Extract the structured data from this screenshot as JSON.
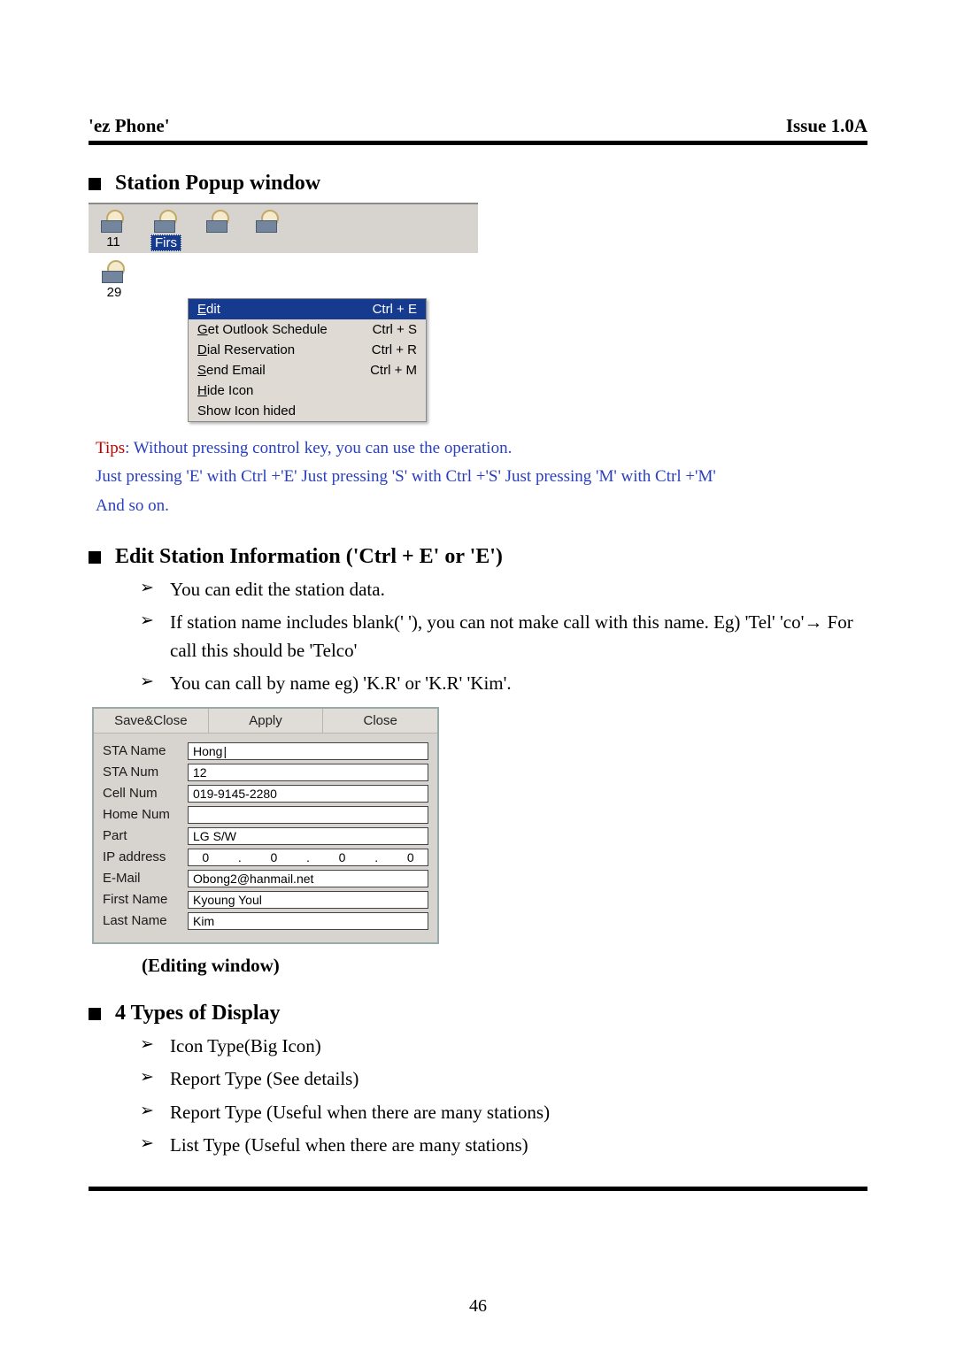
{
  "header": {
    "left": "'ez Phone'",
    "right": "Issue 1.0A"
  },
  "section_popup": {
    "title": "Station Popup window"
  },
  "popup": {
    "icon1_label": "11",
    "icon2_label": "Firs",
    "icon3_label": "29",
    "menu": {
      "item1": {
        "label_pre": "",
        "label_ul": "E",
        "label_post": "dit",
        "shortcut": "Ctrl + E"
      },
      "item2": {
        "label_pre": "",
        "label_ul": "G",
        "label_post": "et Outlook Schedule",
        "shortcut": "Ctrl + S"
      },
      "item3": {
        "label_pre": "",
        "label_ul": "D",
        "label_post": "ial Reservation",
        "shortcut": "Ctrl + R"
      },
      "item4": {
        "label_pre": "",
        "label_ul": "S",
        "label_post": "end Email",
        "shortcut": "Ctrl + M"
      },
      "item5": {
        "label_pre": "",
        "label_ul": "H",
        "label_post": "ide Icon",
        "shortcut": ""
      },
      "item6": {
        "label_pre": "Show Icon hided",
        "label_ul": "",
        "label_post": "",
        "shortcut": ""
      }
    }
  },
  "tips": {
    "lead": "Tips",
    "rest1": ": Without pressing control key, you can use the operation.",
    "line2": "Just pressing 'E' with Ctrl +'E' Just pressing 'S' with Ctrl +'S' Just pressing 'M' with Ctrl +'M'",
    "line3": "And so on."
  },
  "section_edit": {
    "title": "Edit Station Information ('Ctrl + E' or 'E')",
    "bullets": {
      "b1": "You can edit the station data.",
      "b2a": "If station name includes blank(' '), you can not make call with this name. Eg) 'Tel' 'co'",
      "b2arrow": "→",
      "b2b": " For call this should be 'Telco'",
      "b3": "You can call by name eg) 'K.R' or 'K.R' 'Kim'."
    }
  },
  "edit_window": {
    "toolbar": {
      "save_close": "Save&Close",
      "apply": "Apply",
      "close": "Close"
    },
    "labels": {
      "sta_name": "STA Name",
      "sta_num": "STA Num",
      "cell_num": "Cell Num",
      "home_num": "Home Num",
      "part": "Part",
      "ip": "IP address",
      "email": "E-Mail",
      "first_name": "First Name",
      "last_name": "Last Name"
    },
    "values": {
      "sta_name": "Hong",
      "sta_num": "12",
      "cell_num": "019-9145-2280",
      "home_num": "",
      "part": "LG S/W",
      "ip": {
        "a": "0",
        "b": "0",
        "c": "0",
        "d": "0"
      },
      "email": "Obong2@hanmail.net",
      "first_name": "Kyoung Youl",
      "last_name": "Kim"
    }
  },
  "caption_edit": "(Editing window)",
  "section_types": {
    "title": "4 Types of Display",
    "items": {
      "t1": "Icon Type(Big Icon)",
      "t2": "Report Type (See details)",
      "t3": "Report Type (Useful when there are many stations)",
      "t4": "List Type (Useful when there are many stations)"
    }
  },
  "page_number": "46"
}
